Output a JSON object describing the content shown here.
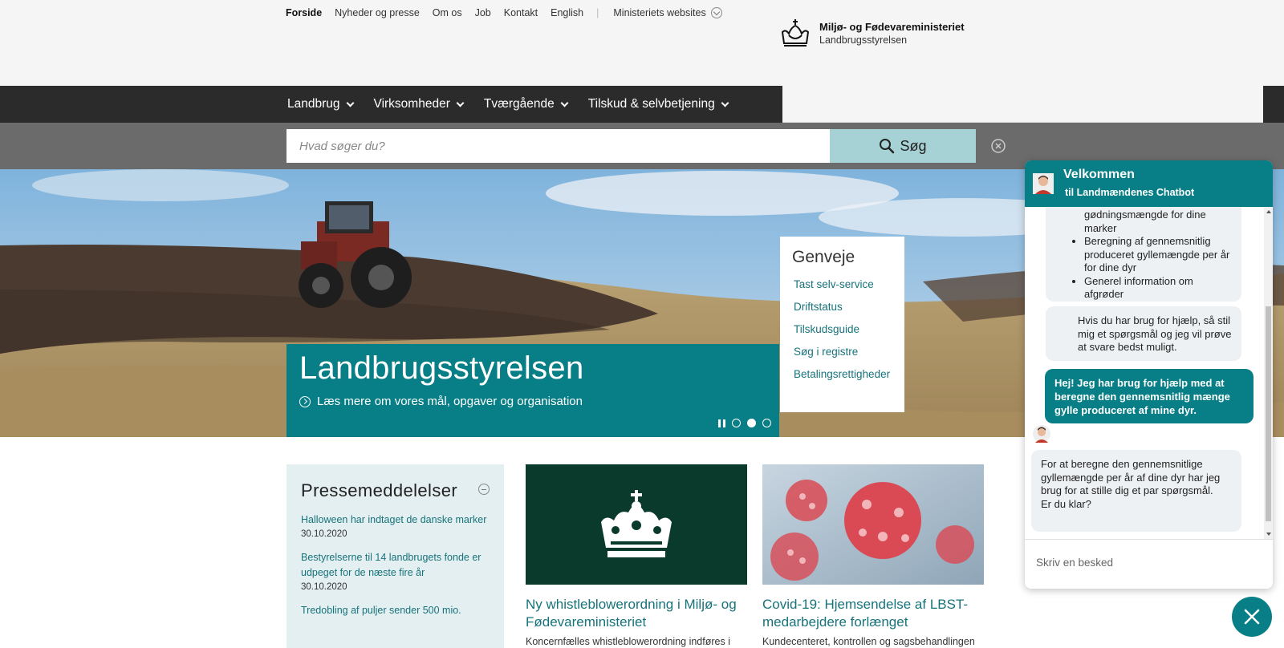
{
  "utility_nav": {
    "items": [
      "Forside",
      "Nyheder og presse",
      "Om os",
      "Job",
      "Kontakt",
      "English"
    ],
    "separator": "|",
    "websites_label": "Ministeriets websites"
  },
  "logo": {
    "title": "Miljø- og Fødevareministeriet",
    "subtitle": "Landbrugsstyrelsen"
  },
  "main_nav": {
    "items": [
      "Landbrug",
      "Virksomheder",
      "Tværgående",
      "Tilskud & selvbetjening"
    ]
  },
  "search": {
    "placeholder": "Hvad søger du?",
    "button_label": "Søg"
  },
  "hero": {
    "title": "Landbrugsstyrelsen",
    "link": "Læs mere om vores mål, opgaver og organisation",
    "carousel_active_index": 1
  },
  "shortcuts": {
    "title": "Genveje",
    "links": [
      "Tast selv-service",
      "Driftstatus",
      "Tilskudsguide",
      "Søg i registre",
      "Betalingsrettigheder"
    ]
  },
  "press": {
    "title": "Pressemeddelelser",
    "items": [
      {
        "title": "Halloween har indtaget de danske marker",
        "date": "30.10.2020"
      },
      {
        "title": "Bestyrelserne til 14 landbrugets fonde er udpeget for de næste fire år",
        "date": "30.10.2020"
      },
      {
        "title": "Tredobling af puljer sender 500 mio.",
        "date": ""
      }
    ]
  },
  "cards": [
    {
      "title": "Ny whistleblowerordning i Miljø- og Fødevareministeriet",
      "desc": "Koncernfælles whistleblowerordning indføres i"
    },
    {
      "title": "Covid-19: Hjemsendelse af LBST-medarbejdere forlænget",
      "desc": "Kundecenteret, kontrollen og sagsbehandlingen"
    }
  ],
  "chat": {
    "title": "Velkommen",
    "subtitle": "til Landmændenes Chatbot",
    "bot_partial_text": "gødningsmængde for dine marker",
    "bot_list": [
      "Beregning af gennemsnitlig produceret gyllemængde per år for dine dyr",
      "Generel information om afgrøder"
    ],
    "bot_help": "Hvis du har brug for hjælp, så stil mig et spørgsmål og jeg vil prøve at svare bedst muligt.",
    "user_message": "Hej! Jeg har brug for hjælp med at beregne den gennemsnitlig mænge gylle produceret af mine dyr.",
    "bot_reply_1": "For at beregne den gennemsnitlige gyllemængde per år af dine dyr har jeg brug for at stille dig et par spørgsmål.",
    "bot_reply_2": "Er du klar?",
    "input_placeholder": "Skriv en besked"
  },
  "colors": {
    "teal": "#087f86",
    "nav_dark": "#2b2b2b",
    "search_gray": "#6b6b6b",
    "search_button": "#a6d2d6",
    "link_teal": "#17737b",
    "press_bg": "#e4eff1"
  },
  "icons": {
    "logo": "crown-icon",
    "search": "magnifier-icon",
    "clear": "close-circle-icon",
    "chat_close": "close-icon"
  }
}
